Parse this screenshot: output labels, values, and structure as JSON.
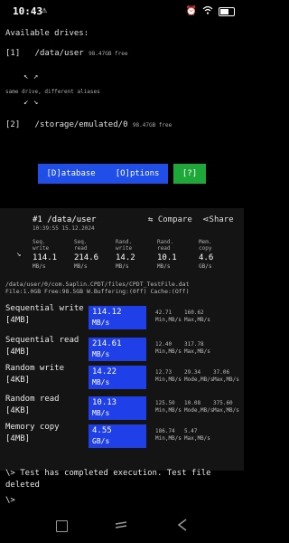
{
  "status_bar": {
    "time": "10:43",
    "alert_icon": "warning-icon",
    "battery_icon": "battery-icon",
    "wifi_icon": "wifi-icon",
    "signal_icon": "signal-icon"
  },
  "drives": {
    "heading": "Available drives:",
    "items": [
      {
        "index": "[1]",
        "path": "/data/user",
        "free": "98.47GB free"
      },
      {
        "index": "[2]",
        "path": "/storage/emulated/0",
        "free": "98.47GB free"
      }
    ],
    "alias_note": "same drive, different aliases"
  },
  "buttons": {
    "database": "[D]atabase",
    "options": "[O]ptions",
    "help": "[?]"
  },
  "result": {
    "title": "#1 /data/user",
    "timestamp": "10:39:55 15.12.2024",
    "compare": "⇆ Compare",
    "share": "⋖Share",
    "stats": [
      {
        "label": "Seq.\nwrite",
        "value": "114.1",
        "unit": "MB/s"
      },
      {
        "label": "Seq.\nread",
        "value": "214.6",
        "unit": "MB/s"
      },
      {
        "label": "Rand.\nwrite",
        "value": "14.2",
        "unit": "MB/s"
      },
      {
        "label": "Rand.\nread",
        "value": "10.1",
        "unit": "MB/s"
      },
      {
        "label": "Mem.\ncopy",
        "value": "4.6",
        "unit": "GB/s"
      }
    ],
    "path_line1": "/data/user/0/com.Saplin.CPDT/files/CPDT_TestFile.dat",
    "path_line2": "File:1.0GB Free:98.5GB W.Buffering:(0ff) Cache:(Off)"
  },
  "tests": [
    {
      "name": "Sequential write",
      "size": "[4MB]",
      "value": "114.12",
      "unit": "MB/s",
      "extras": [
        {
          "v": "42.71",
          "l": "Min,MB/s"
        },
        {
          "v": "160.62",
          "l": "Max,MB/s"
        }
      ]
    },
    {
      "name": "Sequential read",
      "size": "[4MB]",
      "value": "214.61",
      "unit": "MB/s",
      "extras": [
        {
          "v": "12.40",
          "l": "Min,MB/s"
        },
        {
          "v": "317.78",
          "l": "Max,MB/s"
        }
      ]
    },
    {
      "name": "Random write",
      "size": "[4KB]",
      "value": "14.22",
      "unit": "MB/s",
      "extras": [
        {
          "v": "12.73",
          "l": "Min,MB/s"
        },
        {
          "v": "29.34",
          "l": "Mode,MB/s"
        },
        {
          "v": "37.06",
          "l": "Max,MB/s"
        }
      ]
    },
    {
      "name": "Random read",
      "size": "[4KB]",
      "value": "10.13",
      "unit": "MB/s",
      "extras": [
        {
          "v": "125.50",
          "l": "Min,MB/s"
        },
        {
          "v": "10.08",
          "l": "Mode,MB/s"
        },
        {
          "v": "375.60",
          "l": "Max,MB/s"
        }
      ]
    },
    {
      "name": "Memory copy",
      "size": "[4MB]",
      "value": "4.55",
      "unit": "GB/s",
      "extras": [
        {
          "v": "186.74",
          "l": "Min,MB/s"
        },
        {
          "v": "5.47",
          "l": "Max,MB/s"
        }
      ]
    }
  ],
  "console": {
    "line1": "\\> Test has completed execution. Test file deleted",
    "prompt": "\\>"
  },
  "colors": {
    "bar": "#1f3fe8",
    "button_blue": "#1f4ee8",
    "button_green": "#1ea83a",
    "background": "#000000",
    "panel": "#141414"
  }
}
